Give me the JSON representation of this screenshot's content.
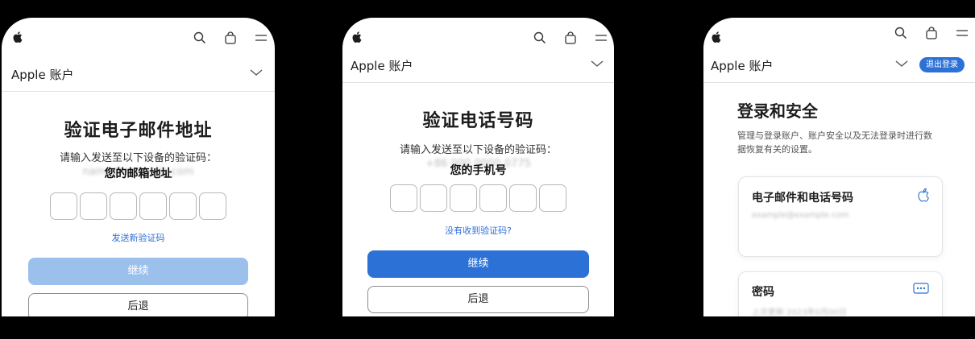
{
  "screens": [
    {
      "nav": {
        "icons": [
          "apple-logo-icon",
          "search-icon",
          "bag-icon",
          "menu-icon"
        ]
      },
      "account_bar": {
        "title": "Apple 账户",
        "chevron": "chevron-down-icon"
      },
      "title": "验证电子邮件地址",
      "instruction": "请输入发送至以下设备的验证码：",
      "masked_value": "name@example.com",
      "target_label": "您的邮箱地址",
      "code_boxes": 6,
      "resend_link": "发送新验证码",
      "continue_label": "继续",
      "continue_state": "disabled",
      "back_label": "后退"
    },
    {
      "nav": {
        "icons": [
          "apple-logo-icon",
          "search-icon",
          "bag-icon",
          "menu-icon"
        ]
      },
      "account_bar": {
        "title": "Apple 账户",
        "chevron": "chevron-down-icon"
      },
      "title": "验证电话号码",
      "instruction": "请输入发送至以下设备的验证码：",
      "masked_value": "+86 000 0000 0775",
      "target_label": "您的手机号",
      "code_boxes": 6,
      "resend_link": "没有收到验证码?",
      "continue_label": "继续",
      "continue_state": "enabled",
      "back_label": "后退"
    },
    {
      "nav": {
        "icons": [
          "apple-logo-icon",
          "search-icon",
          "bag-icon",
          "menu-icon"
        ]
      },
      "account_bar": {
        "title": "Apple 账户",
        "chevron": "chevron-down-icon"
      },
      "sign_out_label": "退出登录",
      "title": "登录和安全",
      "description": "管理与登录账户、账户安全以及无法登录时进行数据恢复有关的设置。",
      "cards": [
        {
          "title": "电子邮件和电话号码",
          "value": "example@example.com",
          "icon": "apple-icon"
        },
        {
          "title": "密码",
          "value": "上次更新 2023年0月00日",
          "icon": "password-dots-icon"
        }
      ]
    }
  ],
  "colors": {
    "accent": "#2c72d6",
    "accent_disabled": "#9cc0ec",
    "link": "#2f6fd6",
    "background": "#000000"
  }
}
